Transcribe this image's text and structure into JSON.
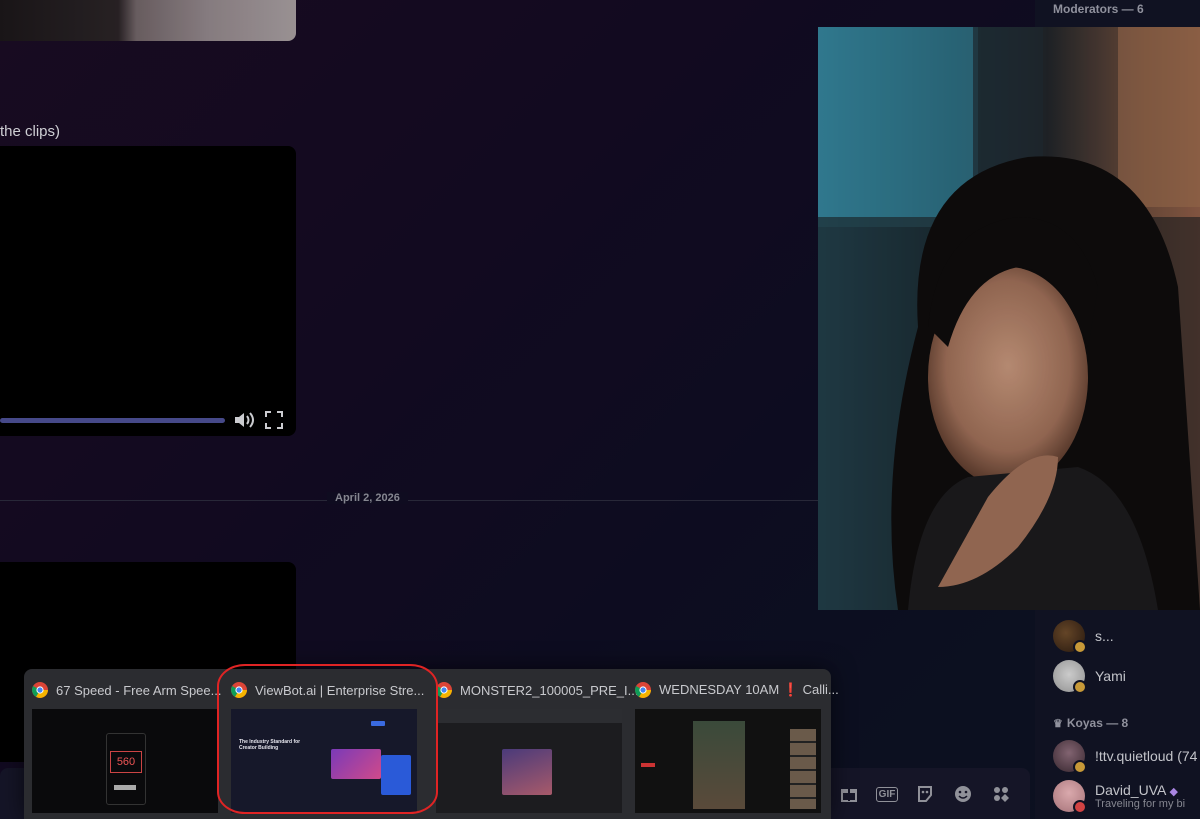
{
  "chat": {
    "message_fragment": "the clips)",
    "date_divider": "April 2, 2026"
  },
  "composer": {
    "icons": [
      "gift-icon",
      "gif-icon",
      "sticker-icon",
      "emoji-icon",
      "apps-icon"
    ],
    "gif_label": "GIF"
  },
  "members": {
    "moderators_header": "Moderators — 6",
    "koyas_header": "Koyas — 8",
    "list": [
      {
        "name": "s...",
        "status": ""
      },
      {
        "name": "Yami",
        "status": ""
      },
      {
        "name": "!ttv.quietloud (74",
        "status": ""
      },
      {
        "name": "David_UVA",
        "status": "Traveling for my bi"
      }
    ]
  },
  "switcher": {
    "tiles": [
      {
        "title": "67 Speed - Free Arm Spee..."
      },
      {
        "title": "ViewBot.ai | Enterprise Stre..."
      },
      {
        "title": "MONSTER2_100005_PRE_I..."
      },
      {
        "title": "WEDNESDAY 10AM ❗ Calli..."
      }
    ],
    "thumb1": {
      "counter": "560"
    },
    "thumb2": {
      "headline": "The Industry Standard for Creator Building"
    }
  },
  "colors": {
    "accent": "#4b4e92",
    "highlight": "#e02424",
    "status_idle": "#d4a33c"
  }
}
